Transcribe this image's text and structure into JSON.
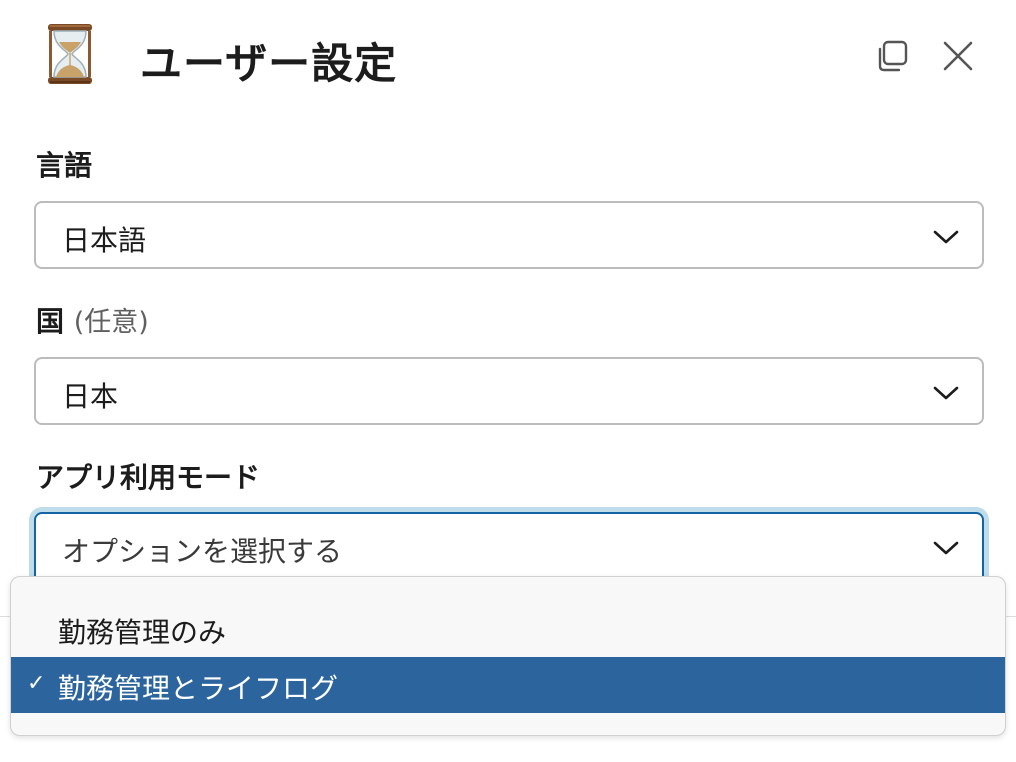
{
  "header": {
    "title": "ユーザー設定",
    "icon": "hourglass-icon",
    "copy_icon": "copy-icon",
    "close_icon": "close-icon"
  },
  "form": {
    "language": {
      "label": "言語",
      "value": "日本語"
    },
    "country": {
      "label": "国",
      "optional": "(任意)",
      "value": "日本"
    },
    "app_mode": {
      "label": "アプリ利用モード",
      "placeholder": "オプションを選択する",
      "options": [
        {
          "label": "勤務管理のみ",
          "selected": false
        },
        {
          "label": "勤務管理とライフログ",
          "selected": true
        }
      ]
    }
  },
  "colors": {
    "accent": "#2c659d",
    "focus_ring": "#bfdceb",
    "text": "#1d1c1d"
  }
}
